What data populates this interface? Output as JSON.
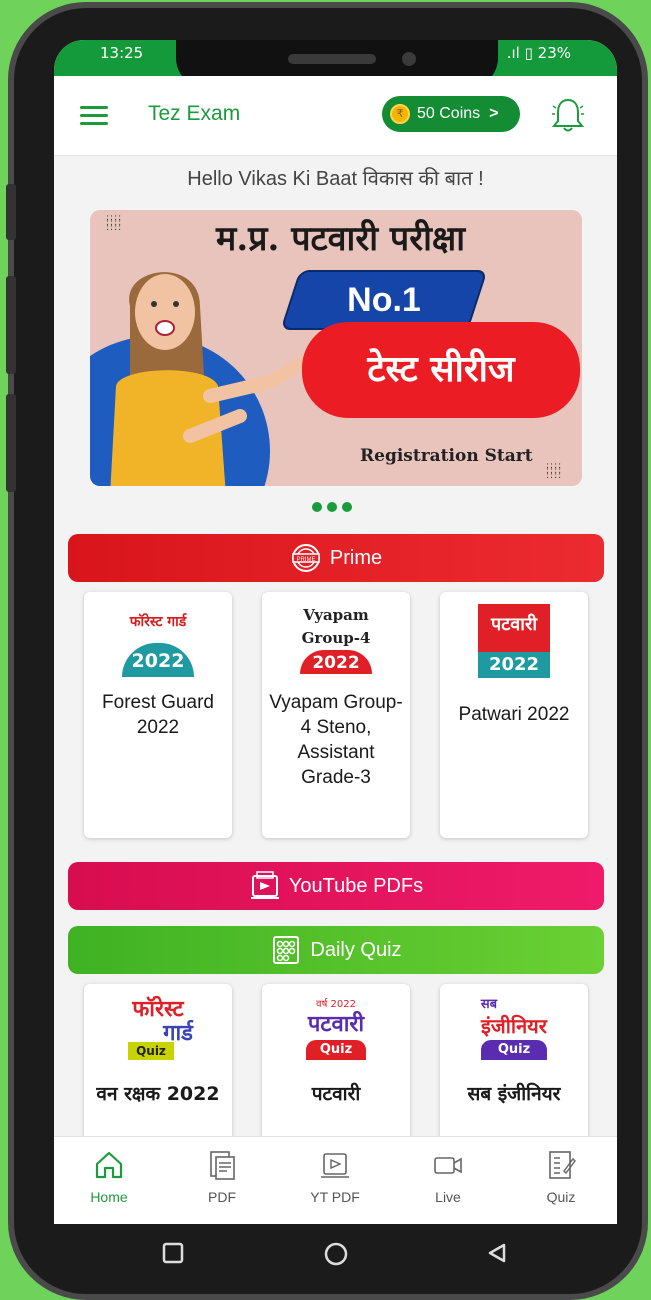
{
  "status_bar": {
    "time": "13:25",
    "battery": "23%"
  },
  "app_bar": {
    "title": "Tez Exam",
    "coins_label": "50 Coins",
    "coins_chevron": ">"
  },
  "greeting": "Hello Vikas Ki Baat विकास की बात !",
  "banner": {
    "heading": "म.प्र. पटवारी परीक्षा",
    "badge": "No.1",
    "highlight": "टेस्ट सीरीज",
    "footer": "Registration Start",
    "slides": 3
  },
  "prime": {
    "title": "Prime",
    "cards": [
      {
        "thumb_top": "फॉरेस्ट गार्ड",
        "thumb_year": "2022",
        "label": "Forest Guard 2022"
      },
      {
        "thumb_top": "Vyapam Group-4",
        "thumb_year": "2022",
        "label": "Vyapam Group-4 Steno, Assistant Grade-3"
      },
      {
        "thumb_top": "पटवारी",
        "thumb_year": "2022",
        "label": "Patwari 2022"
      }
    ]
  },
  "youtube": {
    "title": "YouTube PDFs"
  },
  "daily_quiz": {
    "title": "Daily Quiz",
    "cards": [
      {
        "thumb_top": "फॉरेस्ट",
        "thumb_mid": "गार्ड",
        "thumb_tag": "Quiz",
        "label": "वन रक्षक 2022"
      },
      {
        "thumb_top": "वर्ष 2022",
        "thumb_mid": "पटवारी",
        "thumb_tag": "Quiz",
        "label": "पटवारी"
      },
      {
        "thumb_top": "सब",
        "thumb_mid": "इंजीनियर",
        "thumb_tag": "Quiz",
        "label": "सब इंजीनियर"
      }
    ]
  },
  "nav": [
    {
      "label": "Home",
      "icon": "home-icon",
      "active": true
    },
    {
      "label": "PDF",
      "icon": "pdf-icon"
    },
    {
      "label": "YT PDF",
      "icon": "yt-pdf-icon"
    },
    {
      "label": "Live",
      "icon": "video-icon"
    },
    {
      "label": "Quiz",
      "icon": "quiz-icon"
    }
  ],
  "colors": {
    "brand_green": "#1c9b3d",
    "prime_red": "#e01f26",
    "youtube_pink": "#e0105a",
    "quiz_green": "#4bbf2a",
    "page_bg": "#6fd25a"
  }
}
